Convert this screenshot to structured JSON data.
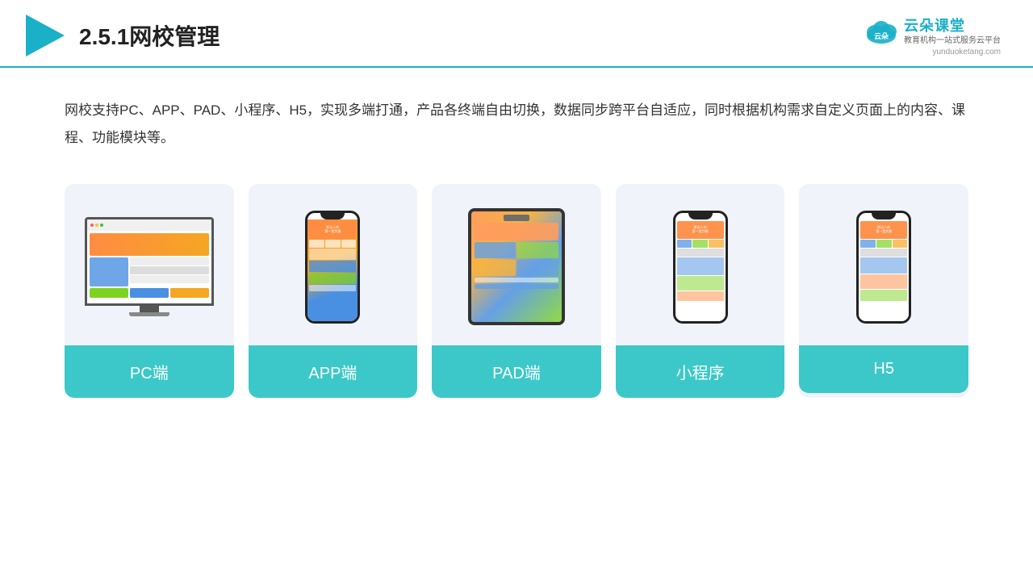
{
  "header": {
    "title": "2.5.1网校管理",
    "logo_name": "云朵课堂",
    "logo_url": "yunduoketang.com",
    "logo_slogan": "教育机构一站式服务云平台"
  },
  "description": {
    "text": "网校支持PC、APP、PAD、小程序、H5，实现多端打通，产品各终端自由切换，数据同步跨平台自适应，同时根据机构需求自定义页面上的内容、课程、功能模块等。"
  },
  "cards": [
    {
      "id": "pc",
      "label": "PC端"
    },
    {
      "id": "app",
      "label": "APP端"
    },
    {
      "id": "pad",
      "label": "PAD端"
    },
    {
      "id": "miniprogram",
      "label": "小程序"
    },
    {
      "id": "h5",
      "label": "H5"
    }
  ],
  "colors": {
    "accent": "#3cc8c8",
    "header_border": "#1ab0c8",
    "card_bg": "#f0f4fa",
    "title": "#222",
    "text": "#333"
  }
}
